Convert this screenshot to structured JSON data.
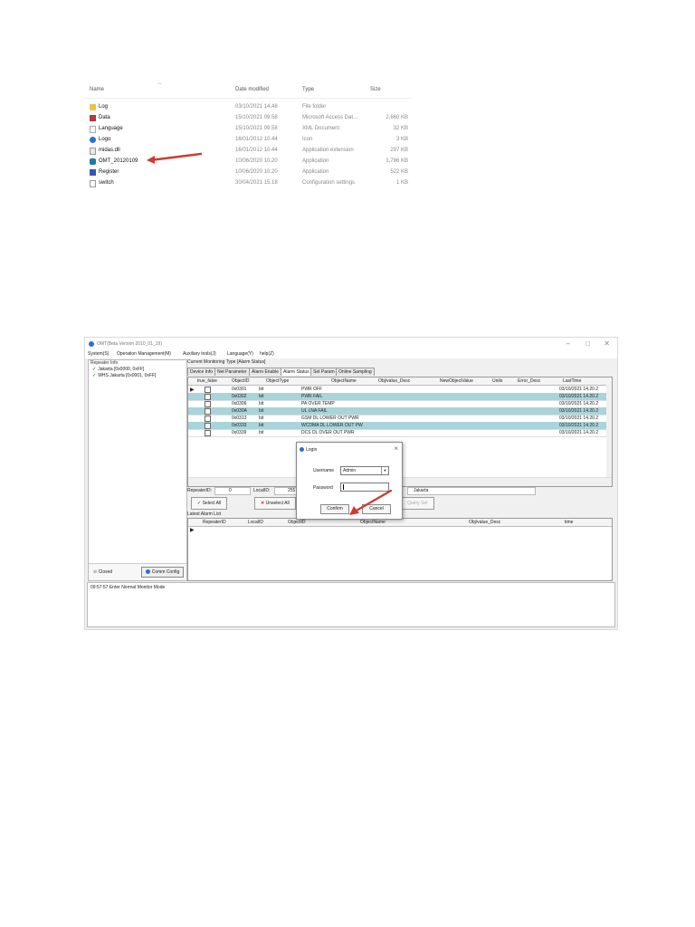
{
  "explorer": {
    "headers": {
      "name": "Name",
      "date": "Date modified",
      "type": "Type",
      "size": "Size"
    },
    "files": [
      {
        "name": "Log",
        "date": "03/10/2021 14.48",
        "type": "File folder",
        "size": "",
        "icon": "folder-icon"
      },
      {
        "name": "Data",
        "date": "15/10/2021 09.58",
        "type": "Microsoft Access Dat...",
        "size": "2,660 KB",
        "icon": "access-db-icon"
      },
      {
        "name": "Language",
        "date": "15/10/2021 09.58",
        "type": "XML Document",
        "size": "32 KB",
        "icon": "xml-file-icon"
      },
      {
        "name": "Logo",
        "date": "16/01/2012 10.44",
        "type": "Icon",
        "size": "3 KB",
        "icon": "logo-icon"
      },
      {
        "name": "midas.dll",
        "date": "16/01/2012 10.44",
        "type": "Application extension",
        "size": "297 KB",
        "icon": "dll-file-icon"
      },
      {
        "name": "OMT_20120109",
        "date": "10/06/2020 10.20",
        "type": "Application",
        "size": "1,786 KB",
        "icon": "app-icon"
      },
      {
        "name": "Register",
        "date": "10/06/2020 10.20",
        "type": "Application",
        "size": "522 KB",
        "icon": "register-app-icon"
      },
      {
        "name": "switch",
        "date": "30/04/2021 15.18",
        "type": "Configuration settings",
        "size": "1 KB",
        "icon": "config-file-icon"
      }
    ]
  },
  "app": {
    "title": "OMT(Beta Version 2010_01_19)",
    "window_controls": {
      "minimize": "–",
      "maximize": "□",
      "close": "✕"
    },
    "menu": [
      "System(S)",
      "Operation Management(M)",
      "Auxiliary tools(J)",
      "Language(Y)",
      "help(Z)"
    ],
    "repeater_label": "Repeater Info",
    "repeaters": [
      "Jakarta [0x0000, 0xFF]",
      "WHS Jakarta [0x0001, 0xFF]"
    ],
    "closed_label": "Closed",
    "comm_config_label": "Comm Config",
    "current_monitoring": "Current Monitoring Type   [Alarm Status]",
    "tabs": [
      "Device Info",
      "Net Parameter",
      "Alarm Enable",
      "Alarm Status",
      "Set Param",
      "Online Sampling"
    ],
    "grid_headers": [
      "true_false",
      "ObjectID",
      "ObjectType",
      "ObjectName",
      "Obj/value_Desc",
      "NewObjectValue",
      "Units",
      "Error_Desc",
      "LastTime"
    ],
    "grid_rows": [
      {
        "id": "0x0301",
        "type": "bit",
        "name": "PWR OFF",
        "time": "03/10/2021 14.20.2"
      },
      {
        "id": "0x0302",
        "type": "bit",
        "name": "PWR FAIL",
        "time": "03/10/2021 14.20.2"
      },
      {
        "id": "0x0306",
        "type": "bit",
        "name": "PA OVER TEMP",
        "time": "03/10/2021 14.20.2"
      },
      {
        "id": "0x030A",
        "type": "bit",
        "name": "UL LNA FAIL",
        "time": "03/10/2021 14.20.2"
      },
      {
        "id": "0x0313",
        "type": "bit",
        "name": "GSM DL LOWER OUT PWR",
        "time": "03/10/2021 14.20.2"
      },
      {
        "id": "0x0333",
        "type": "bit",
        "name": "WCDMA DL LOWER OUT PW",
        "time": "03/10/2021 14.20.2"
      },
      {
        "id": "0x0339",
        "type": "bit",
        "name": "DCS DL OVER OUT PWR",
        "time": "03/10/2021 14.20.2"
      }
    ],
    "info": {
      "repeater_label": "RepeaterID:",
      "repeater_val": "0",
      "local_label": "LocalID:",
      "local_val": "255",
      "site": "Jakarta"
    },
    "buttons": {
      "select_all": "Select All",
      "unselect_all": "Unselect All",
      "query_set": "Query Set"
    },
    "alarm_list_label": "Latest Alarm List",
    "alarm_headers": [
      "RepeaterID",
      "LocalID",
      "ObjectID",
      "ObjectName",
      "Obj/value_Desc",
      "time"
    ],
    "log_line": "09:57:57 Enter Normal Monitor Mode",
    "login": {
      "title": "Login",
      "username_label": "Username",
      "username_value": "Admin",
      "password_label": "Password",
      "confirm": "Confirm",
      "cancel": "Cancel"
    }
  },
  "colors": {
    "highlight_row": "#a9d4d9",
    "arrow": "#d03a30"
  }
}
